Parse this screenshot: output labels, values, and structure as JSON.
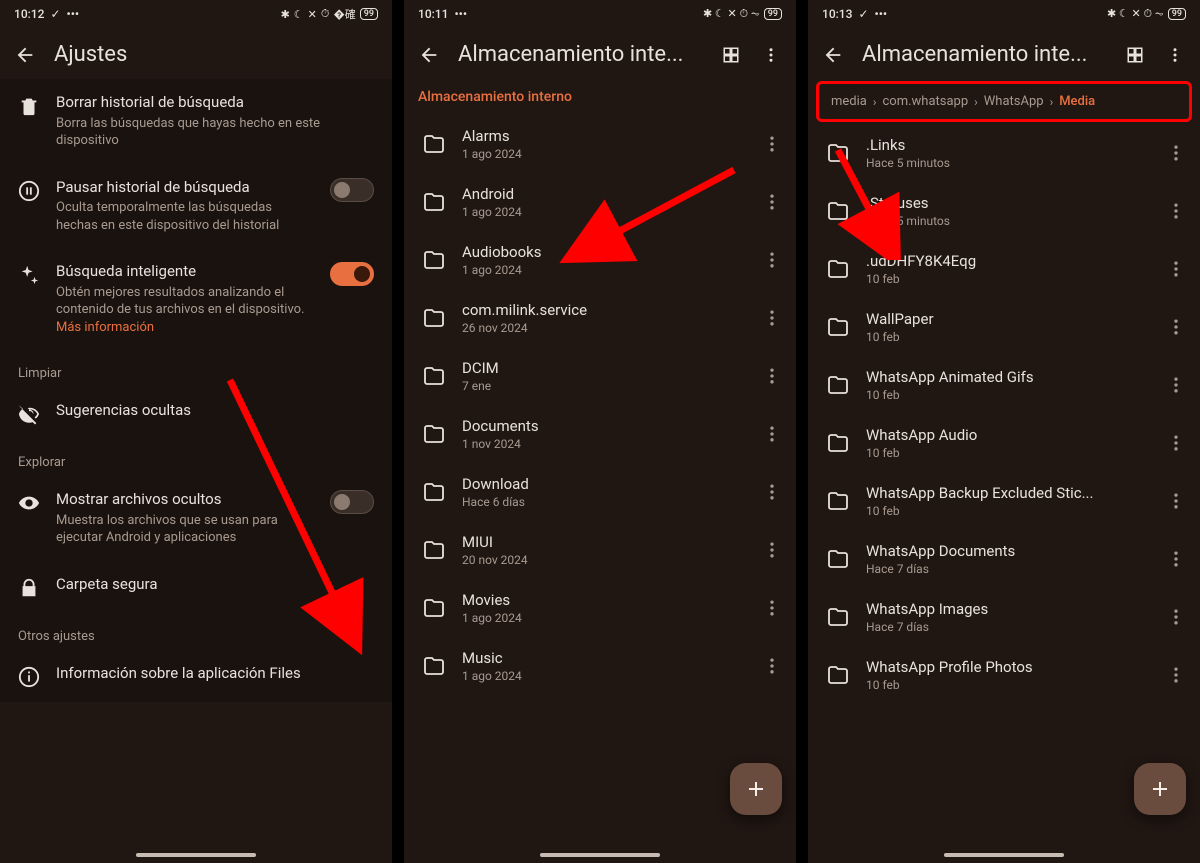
{
  "panes": [
    {
      "status": {
        "time": "10:12",
        "batt": "99"
      },
      "appbar": {
        "title": "Ajustes"
      },
      "rows": [
        {
          "icon": "trash",
          "title": "Borrar historial de búsqueda",
          "sub": "Borra las búsquedas que hayas hecho en este dispositivo"
        },
        {
          "icon": "pause",
          "title": "Pausar historial de búsqueda",
          "sub": "Oculta temporalmente las búsquedas hechas en este dispositivo del historial",
          "toggle": "off"
        },
        {
          "icon": "sparkle",
          "title": "Búsqueda inteligente",
          "sub": "Obtén mejores resultados analizando el contenido de tus archivos en el dispositivo. ",
          "link": "Más información",
          "toggle": "on"
        }
      ],
      "sections": [
        {
          "header": "Limpiar",
          "rows": [
            {
              "icon": "eye-off",
              "title": "Sugerencias ocultas"
            }
          ]
        },
        {
          "header": "Explorar",
          "rows": [
            {
              "icon": "eye",
              "title": "Mostrar archivos ocultos",
              "sub": "Muestra los archivos que se usan para ejecutar Android y aplicaciones",
              "toggle": "off"
            },
            {
              "icon": "lock",
              "title": "Carpeta segura"
            }
          ]
        },
        {
          "header": "Otros ajustes",
          "rows": [
            {
              "icon": "info",
              "title": "Información sobre la aplicación Files"
            }
          ]
        }
      ]
    },
    {
      "status": {
        "time": "10:11",
        "batt": "99"
      },
      "appbar": {
        "title": "Almacenamiento inte..."
      },
      "crumb": "Almacenamiento interno",
      "files": [
        {
          "name": "Alarms",
          "date": "1 ago 2024"
        },
        {
          "name": "Android",
          "date": "1 ago 2024"
        },
        {
          "name": "Audiobooks",
          "date": "1 ago 2024"
        },
        {
          "name": "com.milink.service",
          "date": "26 nov 2024"
        },
        {
          "name": "DCIM",
          "date": "7 ene"
        },
        {
          "name": "Documents",
          "date": "1 nov 2024"
        },
        {
          "name": "Download",
          "date": "Hace 6 días"
        },
        {
          "name": "MIUI",
          "date": "20 nov 2024"
        },
        {
          "name": "Movies",
          "date": "1 ago 2024"
        },
        {
          "name": "Music",
          "date": "1 ago 2024"
        }
      ]
    },
    {
      "status": {
        "time": "10:13",
        "batt": "99"
      },
      "appbar": {
        "title": "Almacenamiento inte..."
      },
      "breadcrumb": [
        "media",
        "com.whatsapp",
        "WhatsApp",
        "Media"
      ],
      "files": [
        {
          "name": ".Links",
          "date": "Hace 5 minutos"
        },
        {
          "name": ".Statuses",
          "date": "Hace 5 minutos"
        },
        {
          "name": ".udDHFY8K4Eqg",
          "date": "10 feb"
        },
        {
          "name": "WallPaper",
          "date": "10 feb"
        },
        {
          "name": "WhatsApp Animated Gifs",
          "date": "10 feb"
        },
        {
          "name": "WhatsApp Audio",
          "date": "10 feb"
        },
        {
          "name": "WhatsApp Backup Excluded Stic...",
          "date": "10 feb"
        },
        {
          "name": "WhatsApp Documents",
          "date": "Hace 7 días"
        },
        {
          "name": "WhatsApp Images",
          "date": "Hace 7 días"
        },
        {
          "name": "WhatsApp Profile Photos",
          "date": "10 feb"
        }
      ]
    }
  ]
}
